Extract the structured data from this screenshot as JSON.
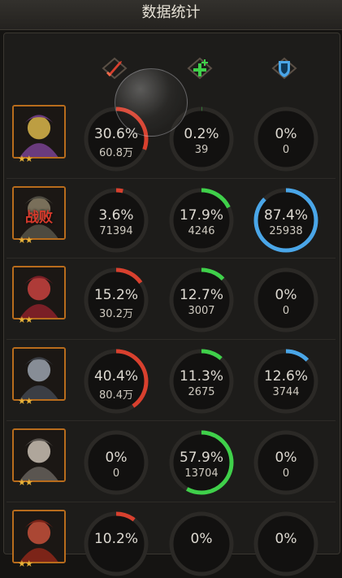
{
  "header": {
    "title": "数据统计"
  },
  "columns": [
    {
      "icon": "sword-damage-icon",
      "color": "#d8402e"
    },
    {
      "icon": "green-cross-heal-icon",
      "color": "#3fd04a"
    },
    {
      "icon": "blue-shield-icon",
      "color": "#4aa6e8"
    }
  ],
  "status": {
    "defeated_label": "战败"
  },
  "heroes": [
    {
      "defeated": false,
      "stars": "★★",
      "stats": [
        {
          "pct_text": "30.6%",
          "count": "60.8万",
          "fill": 0.306
        },
        {
          "pct_text": "0.2%",
          "count": "39",
          "fill": 0.002
        },
        {
          "pct_text": "0%",
          "count": "0",
          "fill": 0
        }
      ]
    },
    {
      "defeated": true,
      "stars": "★★",
      "stats": [
        {
          "pct_text": "3.6%",
          "count": "71394",
          "fill": 0.036
        },
        {
          "pct_text": "17.9%",
          "count": "4246",
          "fill": 0.179
        },
        {
          "pct_text": "87.4%",
          "count": "25938",
          "fill": 0.874
        }
      ]
    },
    {
      "defeated": false,
      "stars": "★★",
      "stats": [
        {
          "pct_text": "15.2%",
          "count": "30.2万",
          "fill": 0.152
        },
        {
          "pct_text": "12.7%",
          "count": "3007",
          "fill": 0.127
        },
        {
          "pct_text": "0%",
          "count": "0",
          "fill": 0
        }
      ]
    },
    {
      "defeated": false,
      "stars": "★★",
      "stats": [
        {
          "pct_text": "40.4%",
          "count": "80.4万",
          "fill": 0.404
        },
        {
          "pct_text": "11.3%",
          "count": "2675",
          "fill": 0.113
        },
        {
          "pct_text": "12.6%",
          "count": "3744",
          "fill": 0.126
        }
      ]
    },
    {
      "defeated": false,
      "stars": "★★",
      "stats": [
        {
          "pct_text": "0%",
          "count": "0",
          "fill": 0
        },
        {
          "pct_text": "57.9%",
          "count": "13704",
          "fill": 0.579
        },
        {
          "pct_text": "0%",
          "count": "0",
          "fill": 0
        }
      ]
    },
    {
      "defeated": false,
      "stars": "★★",
      "stats": [
        {
          "pct_text": "10.2%",
          "count": "",
          "fill": 0.102
        },
        {
          "pct_text": "0%",
          "count": "",
          "fill": 0
        },
        {
          "pct_text": "0%",
          "count": "",
          "fill": 0
        }
      ]
    }
  ]
}
